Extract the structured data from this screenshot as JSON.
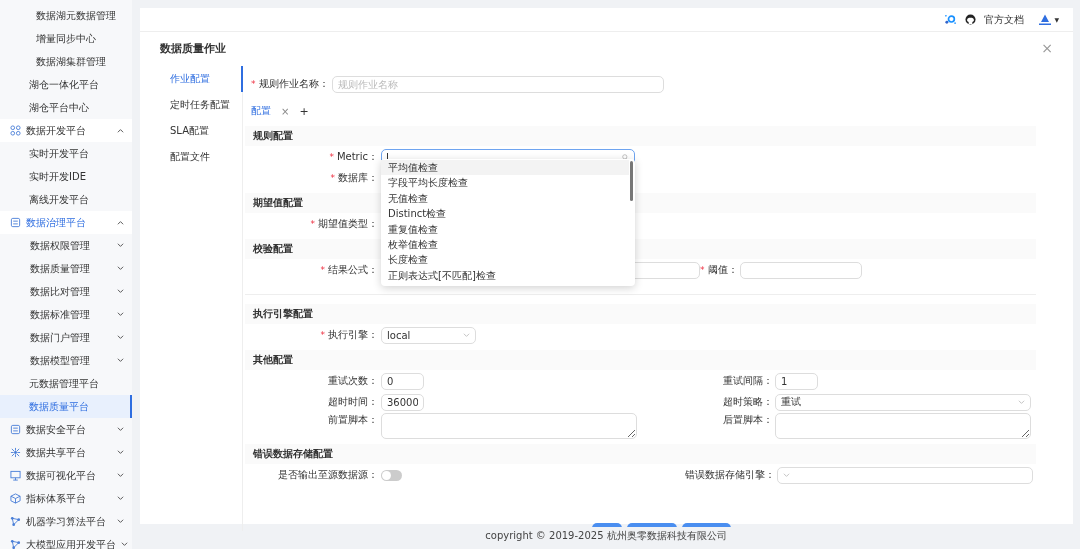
{
  "sidebar": {
    "items": [
      {
        "label": "数据湖元数据管理",
        "kind": "sub",
        "selected": false
      },
      {
        "label": "增量同步中心",
        "kind": "sub",
        "selected": false
      },
      {
        "label": "数据湖集群管理",
        "kind": "sub",
        "selected": false
      },
      {
        "label": "湖仓一体化平台",
        "kind": "leaf",
        "selected": false
      },
      {
        "label": "湖仓平台中心",
        "kind": "leaf",
        "selected": false
      },
      {
        "label": "数据开发平台",
        "kind": "group",
        "expanded": true,
        "selected": false,
        "children": [
          {
            "label": "实时开发平台",
            "kind": "leaf",
            "selected": false
          },
          {
            "label": "实时开发IDE",
            "kind": "leaf",
            "selected": false
          },
          {
            "label": "离线开发平台",
            "kind": "leaf",
            "selected": false
          }
        ]
      },
      {
        "label": "数据治理平台",
        "kind": "group",
        "expanded": true,
        "selected": true,
        "children": [
          {
            "label": "数据权限管理",
            "kind": "subgroup",
            "expanded": false,
            "selected": false
          },
          {
            "label": "数据质量管理",
            "kind": "subgroup",
            "expanded": false,
            "selected": false
          },
          {
            "label": "数据比对管理",
            "kind": "subgroup",
            "expanded": false,
            "selected": false
          },
          {
            "label": "数据标准管理",
            "kind": "subgroup",
            "expanded": false,
            "selected": false
          },
          {
            "label": "数据门户管理",
            "kind": "subgroup",
            "expanded": false,
            "selected": false
          },
          {
            "label": "数据模型管理",
            "kind": "subgroup",
            "expanded": false,
            "selected": false
          },
          {
            "label": "元数据管理平台",
            "kind": "leaf",
            "selected": false
          },
          {
            "label": "数据质量平台",
            "kind": "leaf",
            "selected": true
          }
        ]
      },
      {
        "label": "数据安全平台",
        "kind": "group",
        "expanded": false,
        "selected": false
      },
      {
        "label": "数据共享平台",
        "kind": "group",
        "expanded": false,
        "selected": false
      },
      {
        "label": "数据可视化平台",
        "kind": "group",
        "expanded": false,
        "selected": false
      },
      {
        "label": "指标体系平台",
        "kind": "group",
        "expanded": false,
        "selected": false
      },
      {
        "label": "机器学习算法平台",
        "kind": "group",
        "expanded": false,
        "selected": false
      },
      {
        "label": "大模型应用开发平台",
        "kind": "group",
        "expanded": false,
        "selected": false
      }
    ]
  },
  "header": {
    "docs_link": "官方文档",
    "user_caret": "▼"
  },
  "page": {
    "title": "数据质量作业",
    "close": "×",
    "tabs": [
      {
        "label": "作业配置",
        "selected": true
      },
      {
        "label": "定时任务配置",
        "selected": false
      },
      {
        "label": "SLA配置",
        "selected": false
      },
      {
        "label": "配置文件",
        "selected": false
      }
    ],
    "job_name": {
      "label": "规则作业名称：",
      "required_mark": "*",
      "placeholder": "规则作业名称"
    },
    "config_tabs": [
      {
        "label": "配置",
        "selected": true,
        "close": "×"
      }
    ],
    "add_tab": "+",
    "sections": [
      {
        "title": "规则配置",
        "rows": [
          {
            "kind": "search",
            "label": "Metric：",
            "required_mark": "*",
            "focused": true
          },
          {
            "kind": "hidden",
            "label": "数据库：",
            "required_mark": "*"
          }
        ]
      },
      {
        "title": "期望值配置",
        "rows": [
          {
            "kind": "hidden",
            "label": "期望值类型：",
            "required_mark": "*"
          }
        ]
      },
      {
        "title": "校验配置",
        "rows": [
          {
            "kind": "formula",
            "label": "结果公式：",
            "required_mark": "*",
            "second_label": "阈值：",
            "second_required_mark": "*"
          }
        ],
        "divider": true
      },
      {
        "title": "执行引擎配置",
        "rows": [
          {
            "kind": "select",
            "label": "执行引擎：",
            "required_mark": "*",
            "value": "local"
          }
        ]
      },
      {
        "title": "其他配置",
        "rows": [
          {
            "kind": "pair",
            "label": "重试次数：",
            "value": "0",
            "second": {
              "kind": "input",
              "label": "重试间隔：",
              "value": "1"
            }
          },
          {
            "kind": "pair",
            "label": "超时时间：",
            "value": "36000",
            "second": {
              "kind": "select",
              "label": "超时策略：",
              "value": "重试"
            }
          },
          {
            "kind": "textareas",
            "label": "前置脚本：",
            "second_label": "后置脚本："
          }
        ]
      },
      {
        "title": "错误数据存储配置",
        "rows": [
          {
            "kind": "toggle",
            "label": "是否输出至源数据源：",
            "on": false,
            "second_label": "错误数据存储引擎："
          }
        ]
      }
    ],
    "metric_options": [
      {
        "label": "平均值检查",
        "selected": true
      },
      {
        "label": "字段平均长度检查",
        "selected": false
      },
      {
        "label": "无值检查",
        "selected": false
      },
      {
        "label": "Distinct检查",
        "selected": false
      },
      {
        "label": "重复值检查",
        "selected": false
      },
      {
        "label": "枚举值检查",
        "selected": false
      },
      {
        "label": "长度检查",
        "selected": false
      },
      {
        "label": "正则表达式[不匹配]检查",
        "selected": false
      }
    ],
    "action_buttons": [
      {
        "kind": "primary"
      },
      {
        "kind": "primary"
      },
      {
        "kind": "primary"
      }
    ]
  },
  "footer": {
    "copyright": "copyright © 2019-2025 杭州奥零数据科技有限公司"
  }
}
